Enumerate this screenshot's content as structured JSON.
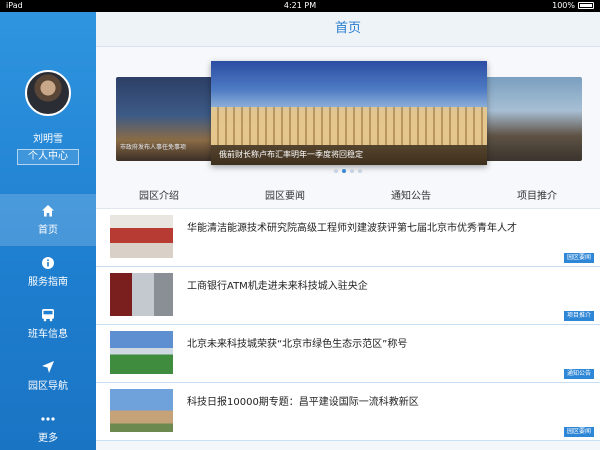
{
  "status": {
    "left": "iPad",
    "time": "4:21 PM",
    "battery": "100%"
  },
  "header": {
    "title": "首页"
  },
  "sidebar": {
    "user_name": "刘明雪",
    "profile_button": "个人中心",
    "items": [
      {
        "icon": "home-icon",
        "label": "首页",
        "active": true
      },
      {
        "icon": "info-icon",
        "label": "服务指南",
        "active": false
      },
      {
        "icon": "bus-icon",
        "label": "班车信息",
        "active": false
      },
      {
        "icon": "navigation-icon",
        "label": "园区导航",
        "active": false
      },
      {
        "icon": "more-icon",
        "label": "更多",
        "active": false
      }
    ]
  },
  "carousel": {
    "left_caption": "市政府发布人事任免事项",
    "main_caption": "俄前财长称卢布汇率明年一季度将回稳定",
    "dots": 4,
    "active_dot": 1
  },
  "tabs": [
    "园区介绍",
    "园区要闻",
    "通知公告",
    "项目推介"
  ],
  "news": [
    {
      "title": "华能清洁能源技术研究院高级工程师刘建波获评第七届北京市优秀青年人才",
      "tag": "园区要闻"
    },
    {
      "title": "工商银行ATM机走进未来科技城入驻央企",
      "tag": "项目推介"
    },
    {
      "title": "北京未来科技城荣获“北京市绿色生态示范区”称号",
      "tag": "通知公告"
    },
    {
      "title": "科技日报10000期专题：昌平建设国际一流科教新区",
      "tag": "园区要闻"
    }
  ]
}
